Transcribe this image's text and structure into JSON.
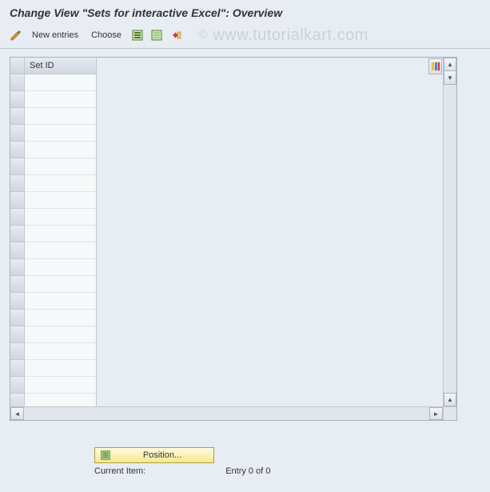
{
  "title": "Change View \"Sets for interactive Excel\": Overview",
  "toolbar": {
    "new_entries_label": "New entries",
    "choose_label": "Choose"
  },
  "table": {
    "column_header": "Set ID",
    "rows": [
      "",
      "",
      "",
      "",
      "",
      "",
      "",
      "",
      "",
      "",
      "",
      "",
      "",
      "",
      "",
      "",
      "",
      "",
      "",
      ""
    ]
  },
  "footer": {
    "position_label": "Position...",
    "current_item_label": "Current Item:",
    "entry_status": "Entry 0 of 0"
  },
  "watermark": {
    "symbol": "©",
    "text": " www.tutorialkart.com"
  }
}
